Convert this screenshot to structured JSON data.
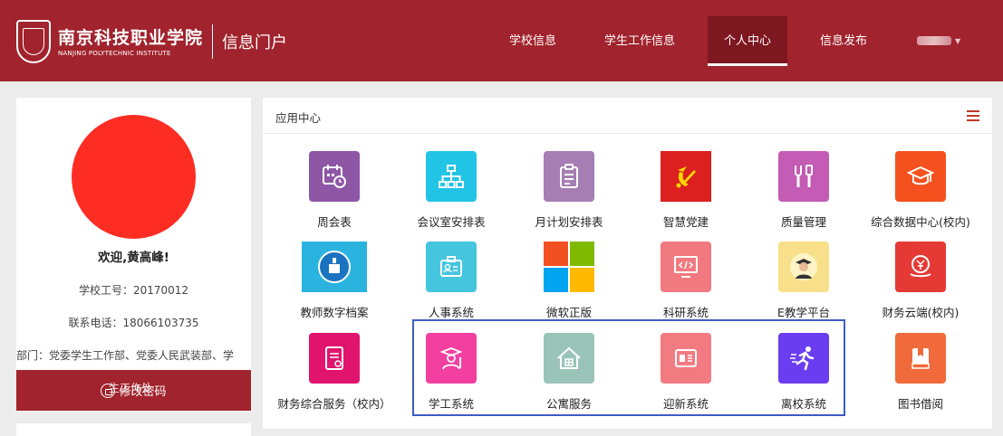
{
  "header": {
    "school_name_cn": "南京科技职业学院",
    "school_name_en": "NANJING POLYTECHNIC INSTITUTE",
    "portal_title": "信息门户",
    "nav": [
      {
        "label": "学校信息",
        "active": false
      },
      {
        "label": "学生工作信息",
        "active": false
      },
      {
        "label": "个人中心",
        "active": true
      },
      {
        "label": "信息发布",
        "active": false
      }
    ]
  },
  "profile": {
    "welcome": "欢迎,黄高峰!",
    "staff_id": "学校工号：20170012",
    "phone": "联系电话：18066103735",
    "department": "部门：党委学生工作部、党委人民武装部、学",
    "department_wrap": "生工作处",
    "change_password": "修改密码"
  },
  "app_center": {
    "title": "应用中心",
    "apps": [
      {
        "label": "周会表",
        "icon": "calendar-icon",
        "color": "#8e57a6"
      },
      {
        "label": "会议室安排表",
        "icon": "org-chart-icon",
        "color": "#22c4e6"
      },
      {
        "label": "月计划安排表",
        "icon": "clipboard-icon",
        "color": "#a67eb3"
      },
      {
        "label": "智慧党建",
        "icon": "party-emblem-icon",
        "color": "#dc1f1f"
      },
      {
        "label": "质量管理",
        "icon": "tools-icon",
        "color": "#c45bb4"
      },
      {
        "label": "综合数据中心(校内)",
        "icon": "graduation-cap-icon",
        "color": "#f4511e"
      },
      {
        "label": "教师数字档案",
        "icon": "podium-icon",
        "color": "#2bb3e0"
      },
      {
        "label": "人事系统",
        "icon": "id-card-icon",
        "color": "#45c6de"
      },
      {
        "label": "微软正版",
        "icon": "windows-logo-icon",
        "color": "#ffffff"
      },
      {
        "label": "科研系统",
        "icon": "code-monitor-icon",
        "color": "#f17a80"
      },
      {
        "label": "E教学平台",
        "icon": "teacher-avatar-icon",
        "color": "#f8e08a"
      },
      {
        "label": "财务云端(校内)",
        "icon": "yen-cloud-icon",
        "color": "#e53935"
      },
      {
        "label": "财务综合服务（校内）",
        "icon": "document-stamp-icon",
        "color": "#e0136d"
      },
      {
        "label": "学工系统",
        "icon": "student-icon",
        "color": "#f23fa0"
      },
      {
        "label": "公寓服务",
        "icon": "house-icon",
        "color": "#9ac4b8"
      },
      {
        "label": "迎新系统",
        "icon": "welcome-card-icon",
        "color": "#f27b82"
      },
      {
        "label": "离校系统",
        "icon": "running-person-icon",
        "color": "#6b3df0"
      },
      {
        "label": "图书借阅",
        "icon": "book-icon",
        "color": "#f06a3c"
      }
    ]
  }
}
